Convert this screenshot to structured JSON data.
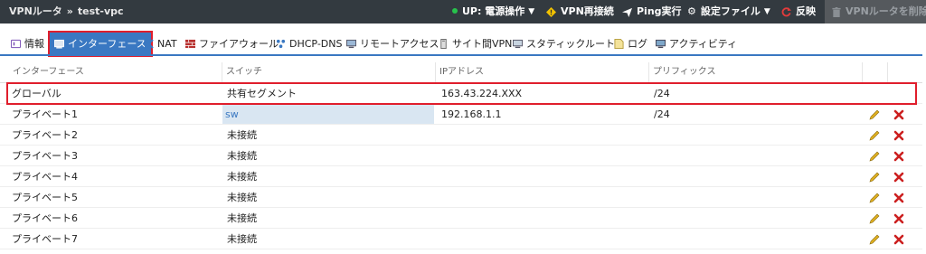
{
  "breadcrumb": {
    "router": "VPNルータ",
    "sep": "»",
    "name": "test-vpc"
  },
  "toolbar": {
    "power": "UP: 電源操作",
    "reconnect": "VPN再接続",
    "ping": "Ping実行",
    "config": "設定ファイル",
    "apply": "反映",
    "delete": "VPNルータを削除"
  },
  "tabs": [
    "情報",
    "インターフェース",
    "NAT",
    "ファイアウォール",
    "DHCP-DNS",
    "リモートアクセス",
    "サイト間VPN",
    "スタティックルート",
    "ログ",
    "アクティビティ"
  ],
  "table": {
    "headers": [
      "インターフェース",
      "スイッチ",
      "IPアドレス",
      "プリフィックス"
    ],
    "rows": [
      {
        "iface": "グローバル",
        "switch": "共有セグメント",
        "ip": "163.43.224.XXX",
        "prefix": "/24"
      },
      {
        "iface": "プライベート1",
        "switch": "sw",
        "ip": "192.168.1.1",
        "prefix": "/24"
      },
      {
        "iface": "プライベート2",
        "switch": "未接続",
        "ip": "",
        "prefix": ""
      },
      {
        "iface": "プライベート3",
        "switch": "未接続",
        "ip": "",
        "prefix": ""
      },
      {
        "iface": "プライベート4",
        "switch": "未接続",
        "ip": "",
        "prefix": ""
      },
      {
        "iface": "プライベート5",
        "switch": "未接続",
        "ip": "",
        "prefix": ""
      },
      {
        "iface": "プライベート6",
        "switch": "未接続",
        "ip": "",
        "prefix": ""
      },
      {
        "iface": "プライベート7",
        "switch": "未接続",
        "ip": "",
        "prefix": ""
      }
    ]
  },
  "colors": {
    "topbar": "#333a40",
    "accent": "#3a78c2",
    "highlight": "#e01e2c",
    "status_up": "#27c24c",
    "delete_icon": "#cc1f1f",
    "edit_icon": "#e0b020"
  }
}
